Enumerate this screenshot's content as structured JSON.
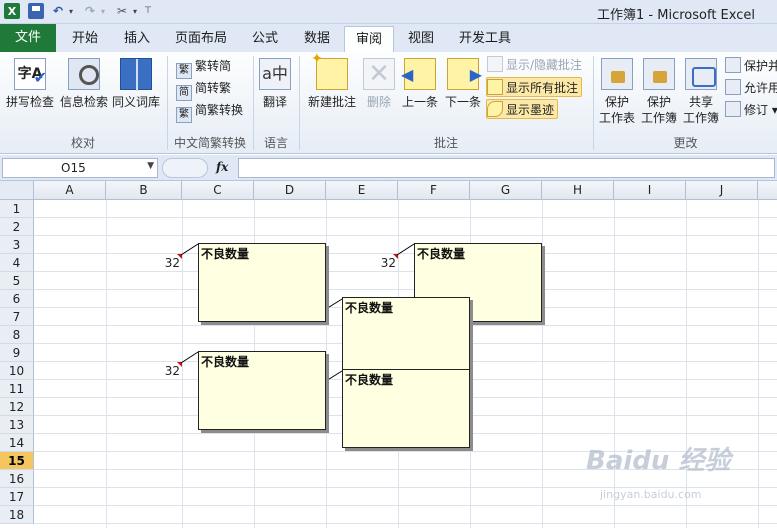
{
  "window": {
    "title": "工作簿1 - Microsoft Excel"
  },
  "quick_access": {
    "app_icon": "X"
  },
  "tabs": [
    {
      "label": "文件"
    },
    {
      "label": "开始"
    },
    {
      "label": "插入"
    },
    {
      "label": "页面布局"
    },
    {
      "label": "公式"
    },
    {
      "label": "数据"
    },
    {
      "label": "审阅"
    },
    {
      "label": "视图"
    },
    {
      "label": "开发工具"
    }
  ],
  "active_tab": "审阅",
  "ribbon": {
    "proofing": {
      "label": "校对",
      "spelling": "拼写检查",
      "research": "信息检索",
      "thesaurus": "同义词库",
      "spelling_icon_text": "字A"
    },
    "chinese": {
      "label": "中文简繁转换",
      "to_simplified": "繁转简",
      "to_traditional": "简转繁",
      "convert": "简繁转换",
      "icon_trad": "繁",
      "icon_simp": "简",
      "icon_conv": "繁"
    },
    "language": {
      "label": "语言",
      "translate": "翻译",
      "icon_text": "a中"
    },
    "comments": {
      "label": "批注",
      "new": "新建批注",
      "delete": "删除",
      "prev": "上一条",
      "next": "下一条",
      "show_hide": "显示/隐藏批注",
      "show_all": "显示所有批注",
      "show_ink": "显示墨迹"
    },
    "changes": {
      "label": "更改",
      "protect_sheet_1": "保护",
      "protect_sheet_2": "工作表",
      "protect_wb_1": "保护",
      "protect_wb_2": "工作簿",
      "share_wb_1": "共享",
      "share_wb_2": "工作簿",
      "protect_share": "保护并",
      "allow_edit": "允许用",
      "track": "修订"
    }
  },
  "formula_bar": {
    "name_box": "O15",
    "fx": "fx",
    "value": ""
  },
  "columns": [
    "A",
    "B",
    "C",
    "D",
    "E",
    "F",
    "G",
    "H",
    "I",
    "J"
  ],
  "rows": [
    "1",
    "2",
    "3",
    "4",
    "5",
    "6",
    "7",
    "8",
    "9",
    "10",
    "11",
    "12",
    "13",
    "14",
    "15",
    "16",
    "17",
    "18"
  ],
  "selected_row": "15",
  "cells": [
    {
      "ref": "B4",
      "value": "32"
    },
    {
      "ref": "E4",
      "value": "32"
    },
    {
      "ref": "B10",
      "value": "32"
    }
  ],
  "comments": [
    {
      "text": "不良数量"
    },
    {
      "text": "不良数量"
    },
    {
      "text": "不良数量"
    },
    {
      "text": "不良数量"
    },
    {
      "text": "不良数量"
    }
  ],
  "watermark": {
    "text": "Baidu 经验",
    "sub": "jingyan.baidu.com"
  }
}
